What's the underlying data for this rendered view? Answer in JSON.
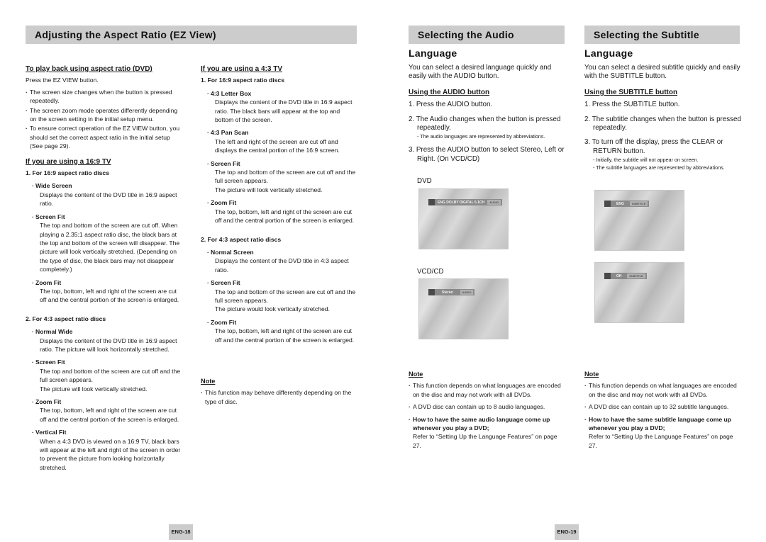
{
  "headers": {
    "left": "Adjusting the Aspect Ratio (EZ View)",
    "audio": "Selecting the Audio Language",
    "subtitle": "Selecting the Subtitle Language"
  },
  "col1": {
    "title": "To play back using aspect ratio (DVD)",
    "intro": "Press the EZ VIEW button.",
    "bullets": [
      "The screen size changes when the button is pressed repeatedly.",
      "The screen zoom mode operates differently depending on the screen setting in the initial setup menu.",
      "To ensure correct operation of the EZ VIEW button, you should set the correct aspect ratio in the initial setup (See page 29)."
    ],
    "tv169": {
      "title": "If you are using a 16:9 TV",
      "sec1": {
        "heading": "1. For 16:9 aspect ratio discs",
        "items": [
          {
            "name": "Wide Screen",
            "desc": "Displays the content of the DVD title in 16:9 aspect ratio."
          },
          {
            "name": "Screen Fit",
            "desc": "The top and bottom of the screen are cut off. When playing a 2.35:1 aspect ratio disc, the black bars at the top and bottom of the screen will disappear. The picture will look vertically stretched. (Depending on the type of disc, the black bars may not disappear completely.)"
          },
          {
            "name": "Zoom Fit",
            "desc": "The top, bottom, left and right of the screen are cut off and the central portion of the screen is enlarged."
          }
        ]
      },
      "sec2": {
        "heading": "2. For 4:3 aspect ratio discs",
        "items": [
          {
            "name": "Normal Wide",
            "desc": "Displays the content of the DVD title in 16:9 aspect ratio. The picture will look horizontally stretched."
          },
          {
            "name": "Screen Fit",
            "desc": "The top and bottom of the screen are cut off and the full screen appears.",
            "desc2": "The picture will look vertically stretched."
          },
          {
            "name": "Zoom Fit",
            "desc": "The top, bottom, left and right of the screen are cut off and the central portion of the screen is enlarged."
          },
          {
            "name": "Vertical Fit",
            "desc": "When a 4:3 DVD is viewed on a 16:9 TV, black bars will appear at the left and right of the screen in order to prevent the picture from looking horizontally stretched."
          }
        ]
      }
    }
  },
  "col2": {
    "title": "If you are using a 4:3 TV",
    "sec1": {
      "heading": "1. For 16:9 aspect ratio discs",
      "items": [
        {
          "name": "4:3 Letter Box",
          "desc": "Displays the content of the DVD title in 16:9 aspect ratio. The black bars will appear at the top and bottom of the screen."
        },
        {
          "name": "4:3 Pan Scan",
          "desc": "The left and right of the screen are cut off and displays the central portion of the 16:9 screen."
        },
        {
          "name": "Screen Fit",
          "desc": "The top and bottom of the screen are cut off and the full screen appears.",
          "desc2": "The picture will look vertically stretched."
        },
        {
          "name": "Zoom Fit",
          "desc": "The top, bottom, left and right of the screen are cut off and the central portion of the screen is enlarged."
        }
      ]
    },
    "sec2": {
      "heading": "2. For 4:3 aspect ratio discs",
      "items": [
        {
          "name": "Normal Screen",
          "desc": "Displays the content of the DVD title in 4:3 aspect ratio."
        },
        {
          "name": "Screen Fit",
          "desc": "The top and bottom of the screen are cut off and the full screen appears.",
          "desc2": "The picture would look vertically stretched."
        },
        {
          "name": "Zoom Fit",
          "desc": "The top, bottom, left and right of the screen are cut off and the central portion of the screen is enlarged."
        }
      ]
    },
    "note": {
      "title": "Note",
      "bullets": [
        "This function may behave differently depending on the type of disc."
      ]
    }
  },
  "audio": {
    "intro": "You can select a desired language quickly and easily with the AUDIO button.",
    "title": "Using the AUDIO button",
    "steps": [
      {
        "text": "1. Press the AUDIO button."
      },
      {
        "text": "2. The Audio changes when the button is pressed repeatedly.",
        "hint": "- The audio languages are represented by abbreviations."
      },
      {
        "text": "3. Press the AUDIO button to select Stereo, Left or Right. (On VCD/CD)"
      }
    ],
    "dvd_label": "DVD",
    "dvd_osd": {
      "text": "ENG  DOLBY DIGITAL  5.1CH",
      "tag": "AUDIO"
    },
    "vcd_label": "VCD/CD",
    "vcd_osd": {
      "text": "Stereo",
      "tag": "AUDIO"
    },
    "note": {
      "title": "Note",
      "bullets": [
        "This function depends on what languages are encoded on the disc and may not work with all DVDs.",
        "A DVD disc can contain up to 8 audio languages."
      ],
      "bold_bullet": "How to have the same audio language come up whenever you play a DVD;",
      "bold_follow": "Refer to “Setting Up the Language Features” on page 27."
    }
  },
  "subtitle": {
    "intro": "You can select a desired subtitle quickly and easily with the SUBTITLE button.",
    "title": "Using the SUBTITLE button",
    "steps": [
      {
        "text": "1. Press the SUBTITLE button."
      },
      {
        "text": "2. The subtitle changes when the button is pressed repeatedly."
      },
      {
        "text": "3. To turn off the display, press the CLEAR or RETURN button.",
        "hint": "- Initially, the subtitle will not appear on screen.",
        "hint2": "- The subtitle languages are represented by abbreviations."
      }
    ],
    "osd1": {
      "text": "ENG",
      "tag": "SUBTITLE"
    },
    "osd2": {
      "text": "Off",
      "tag": "SUBTITLE"
    },
    "note": {
      "title": "Note",
      "bullets": [
        "This function depends on what languages are encoded on the disc and may not work with all DVDs.",
        "A DVD disc can contain up to 32 subtitle languages."
      ],
      "bold_bullet": "How to have the same subtitle language come up whenever you play a DVD;",
      "bold_follow": "Refer to “Setting Up the Language Features” on page 27."
    }
  },
  "pages": {
    "left": "ENG-18",
    "right": "ENG-19"
  }
}
